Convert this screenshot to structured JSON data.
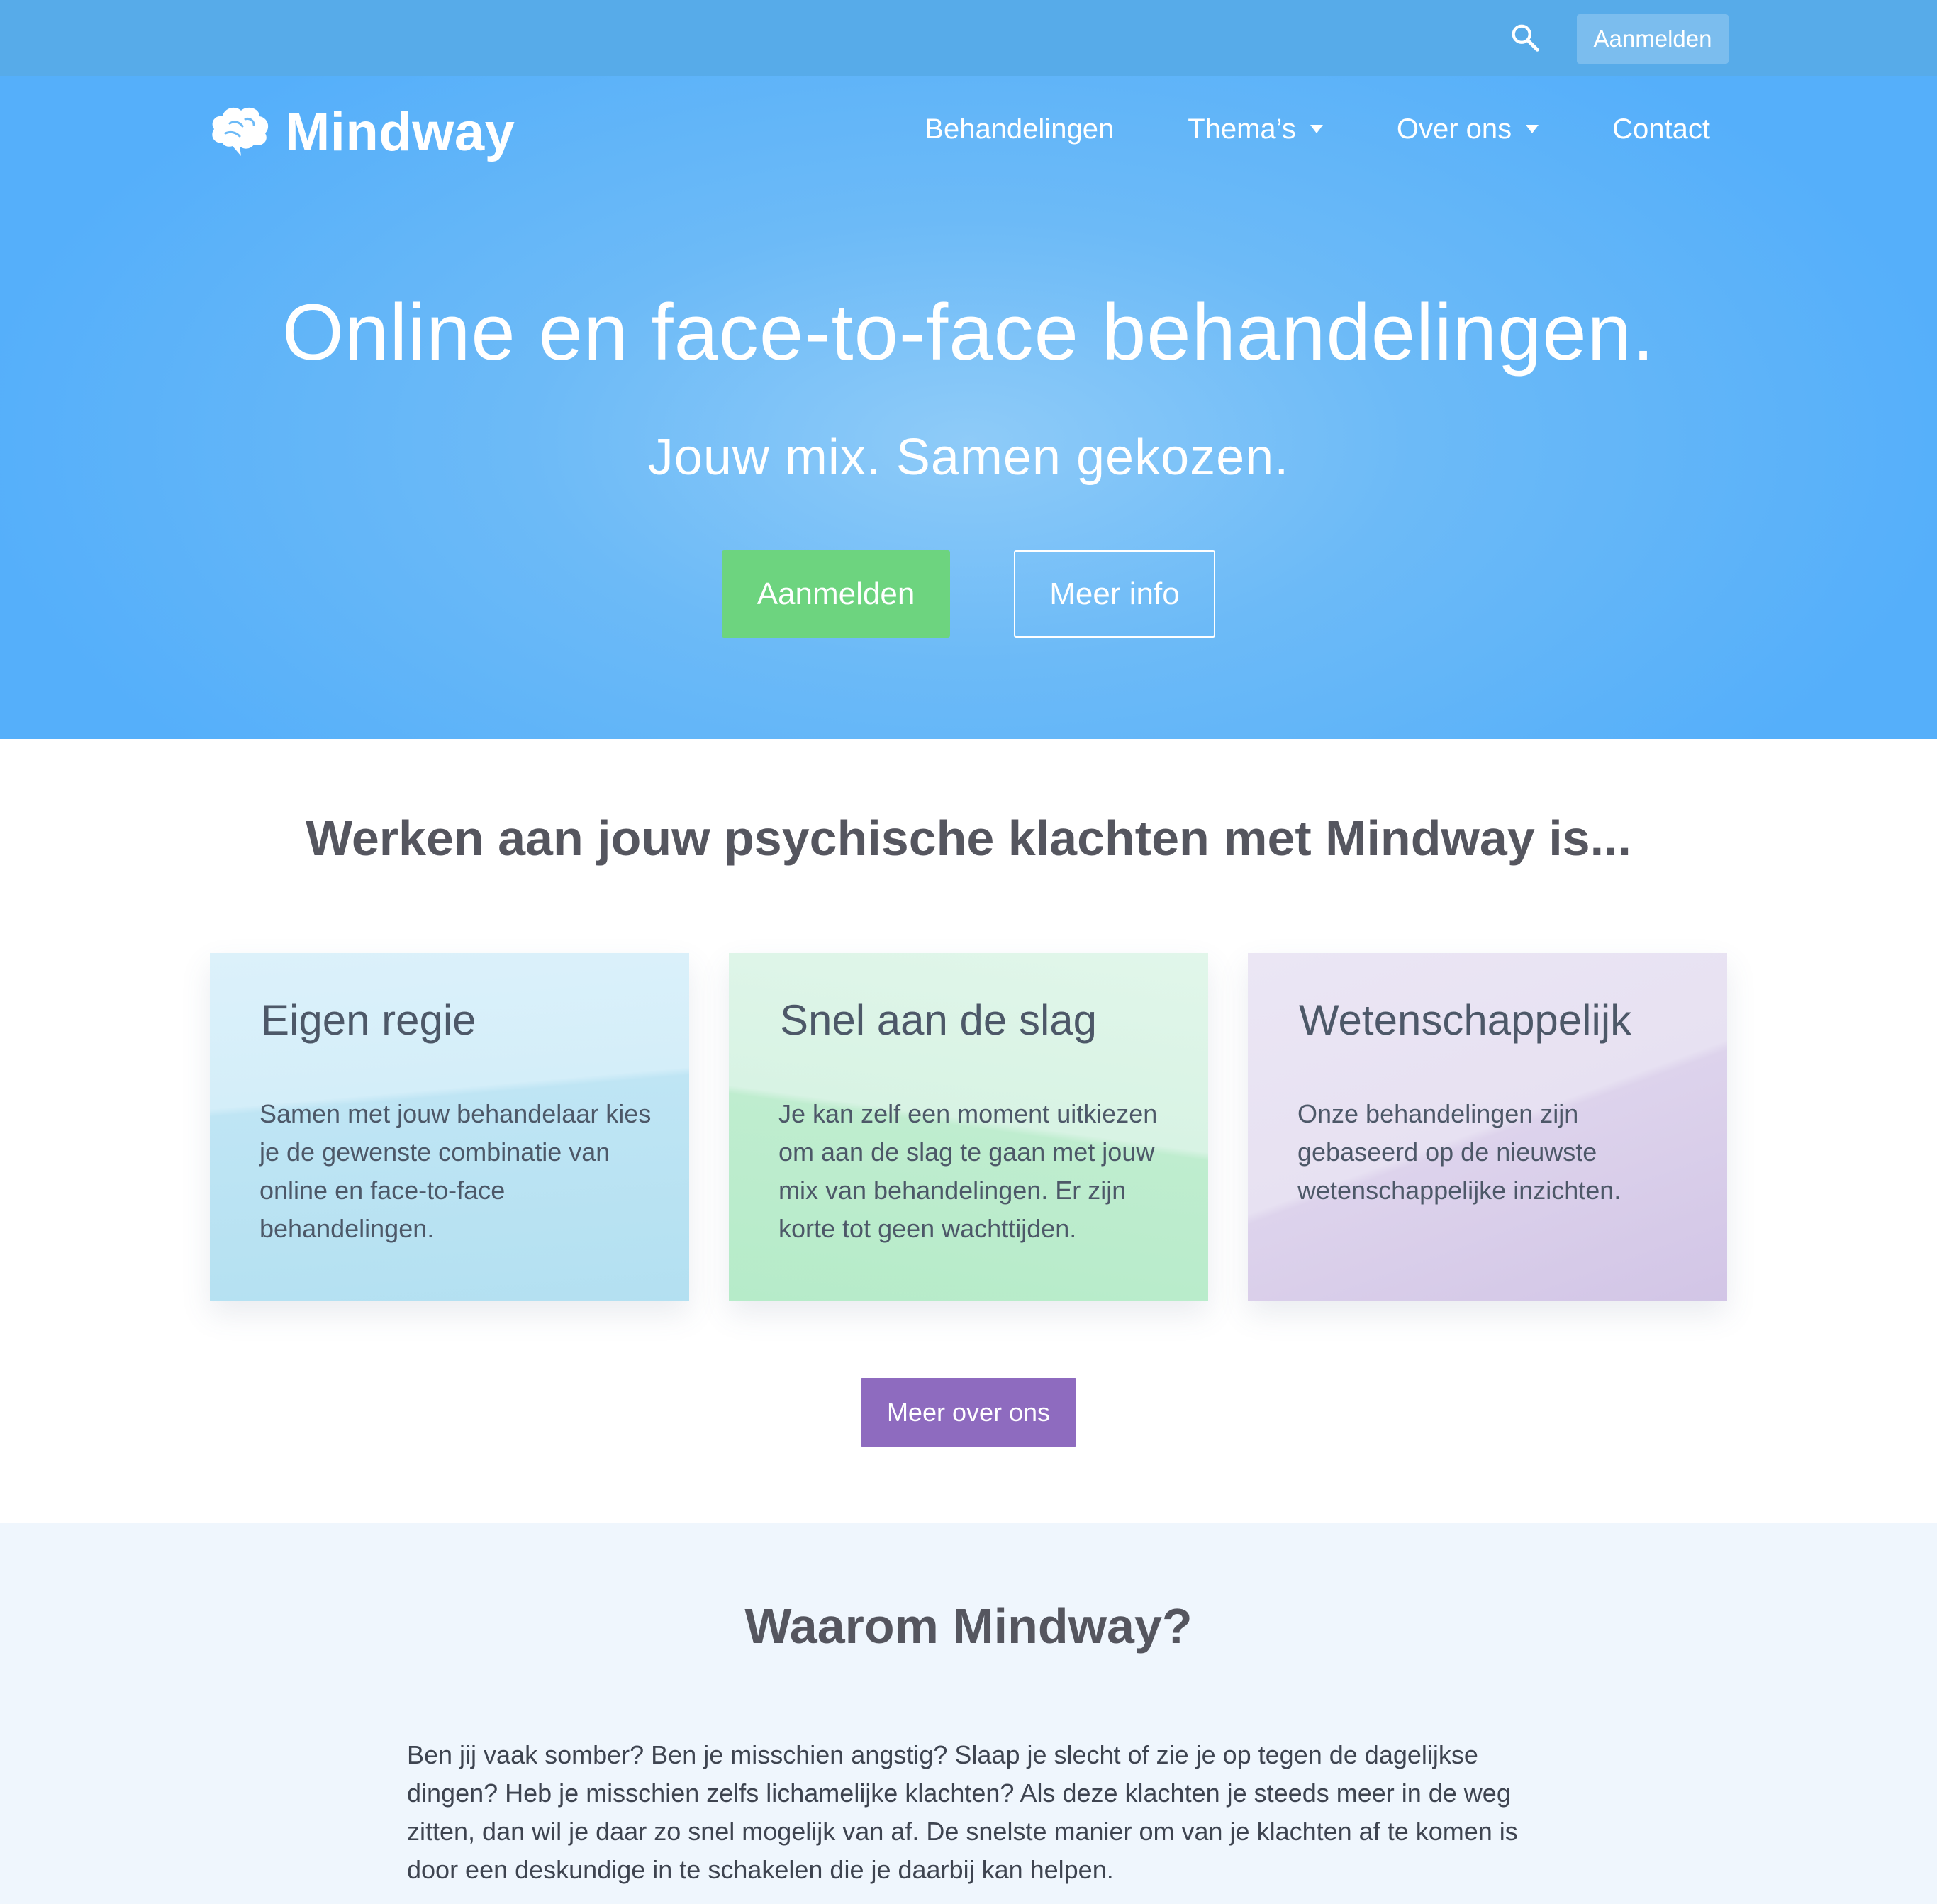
{
  "topbar": {
    "search_icon": "search-icon",
    "aanmelden_label": "Aanmelden"
  },
  "header": {
    "logo_icon": "brain-icon",
    "logo_text": "Mindway",
    "nav": [
      {
        "label": "Behandelingen",
        "has_dropdown": false
      },
      {
        "label": "Thema’s",
        "has_dropdown": true
      },
      {
        "label": "Over ons",
        "has_dropdown": true
      },
      {
        "label": "Contact",
        "has_dropdown": false
      }
    ]
  },
  "hero": {
    "title": "Online en face-to-face behandelingen.",
    "subtitle": "Jouw mix. Samen gekozen.",
    "primary_button": "Aanmelden",
    "secondary_button": "Meer info"
  },
  "features": {
    "title": "Werken aan jouw psychische klachten met Mindway is...",
    "cards": [
      {
        "title": "Eigen regie",
        "text": "Samen met jouw behandelaar kies je de gewenste combinatie van online en face-to-face behandelingen."
      },
      {
        "title": "Snel aan de slag",
        "text": "Je kan zelf een moment uitkiezen om aan de slag te gaan met jouw mix van behandelingen. Er zijn korte tot geen wachttijden."
      },
      {
        "title": "Wetenschappelijk",
        "text": "Onze behandelingen zijn gebaseerd op de nieuwste wetenschappelijke inzichten."
      }
    ],
    "button": "Meer over ons"
  },
  "why": {
    "title": "Waarom Mindway?",
    "text": "Ben jij vaak somber? Ben je misschien angstig? Slaap je slecht of zie je op tegen de dagelijkse dingen? Heb je misschien zelfs lichamelijke klachten? Als deze klachten je steeds meer in de weg zitten, dan wil je daar zo snel mogelijk van af. De snelste manier om van je klachten af te komen is door een deskundige in te schakelen die je daarbij kan helpen."
  },
  "colors": {
    "topbar": "#57abe9",
    "hero": "#6cbaf7",
    "green_button": "#6dd47f",
    "purple_button": "#8e6bbf",
    "heading_text": "#55565f",
    "why_background": "#eff6fd"
  }
}
